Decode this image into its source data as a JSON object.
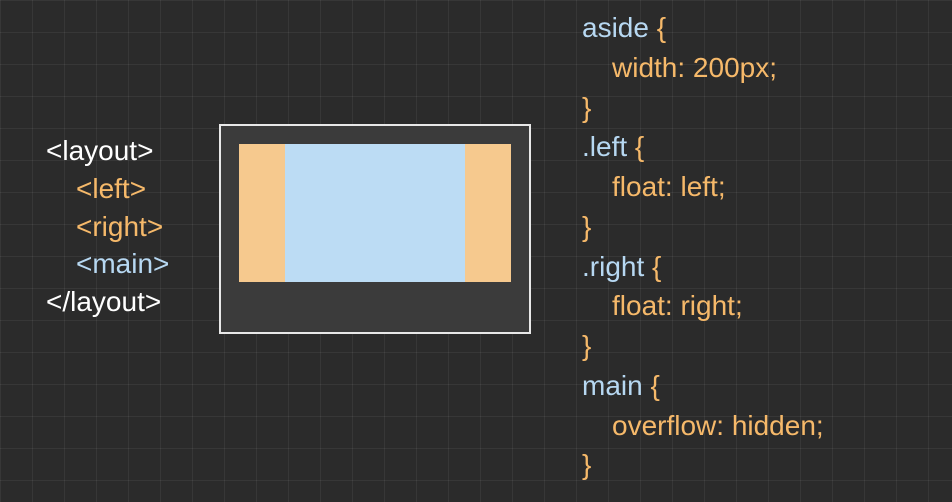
{
  "html": {
    "open": "<layout>",
    "left": "<left>",
    "right": "<right>",
    "main": "<main>",
    "close": "</layout>"
  },
  "css": {
    "r1_sel": "aside ",
    "r1_brace_open": "{",
    "r1_prop": "width: 200px;",
    "r1_brace_close": "}",
    "r2_sel": ".left ",
    "r2_brace_open": "{",
    "r2_prop": "float: left;",
    "r2_brace_close": "}",
    "r3_sel": ".right ",
    "r3_brace_open": "{",
    "r3_prop": "float: right;",
    "r3_brace_close": "}",
    "r4_sel": "main ",
    "r4_brace_open": "{",
    "r4_prop": "overflow: hidden;",
    "r4_brace_close": "}"
  }
}
